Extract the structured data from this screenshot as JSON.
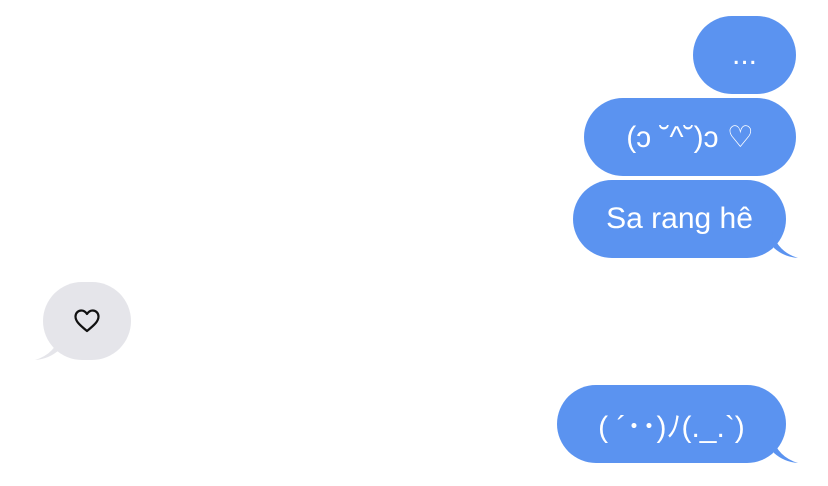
{
  "conversation": {
    "messages": [
      {
        "direction": "sent",
        "text": "..."
      },
      {
        "direction": "sent",
        "text": "(ɔ ˘^˘)ɔ ♡"
      },
      {
        "direction": "sent",
        "text": "Sa rang hê"
      },
      {
        "direction": "received",
        "text": "♡",
        "icon": "heart-icon"
      },
      {
        "direction": "sent",
        "text": "( ´･･)ﾉ(._.`)"
      }
    ]
  },
  "colors": {
    "sent_bubble": "#5b93f0",
    "received_bubble": "#e5e5ea",
    "background": "#ffffff"
  }
}
